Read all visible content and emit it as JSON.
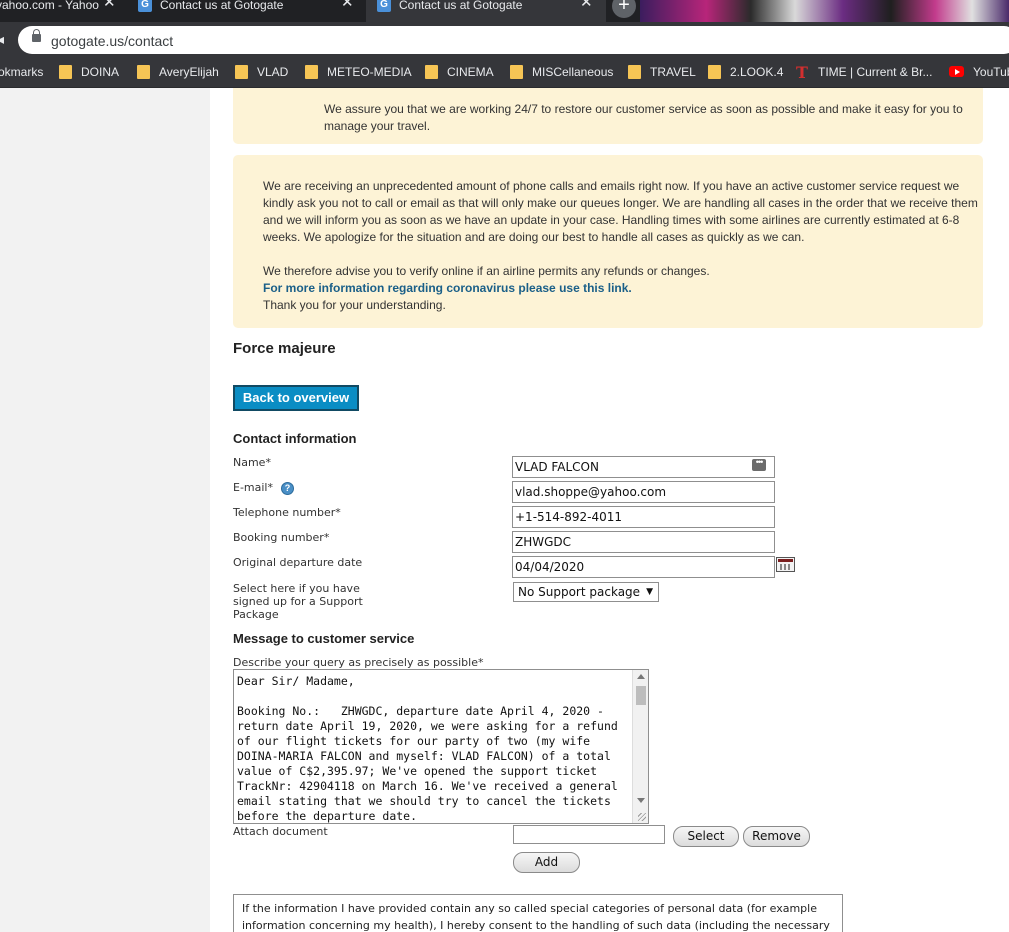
{
  "browser": {
    "tabs": [
      {
        "label": "yahoo.com - Yahoo"
      },
      {
        "label": "Contact us at Gotogate"
      },
      {
        "label": "Contact us at Gotogate"
      }
    ],
    "new_tab": "+",
    "url": "gotogate.us/contact",
    "bookmarks": [
      {
        "label": "okmarks"
      },
      {
        "label": "DOINA"
      },
      {
        "label": "AveryElijah"
      },
      {
        "label": "VLAD"
      },
      {
        "label": "METEO-MEDIA"
      },
      {
        "label": "CINEMA"
      },
      {
        "label": "MISCellaneous"
      },
      {
        "label": "TRAVEL"
      },
      {
        "label": "2.LOOK.4"
      },
      {
        "label": "TIME | Current & Br..."
      },
      {
        "label": "YouTub"
      }
    ]
  },
  "notice": {
    "first": "We assure you that we are working 24/7 to restore our customer service as soon as possible and make it easy for you to manage your travel.",
    "para1": "We are receiving an unprecedented amount of phone calls and emails right now. If you have an active customer service request we kindly ask you not to call or email as that will only make our queues longer. We are handling all cases in the order that we receive them and we will inform you as soon as we have an update in your case. Handling times with some airlines are currently estimated at 6-8 weeks. We apologize for the situation and are doing our best to handle all cases as quickly as we can.",
    "para2": "We therefore advise you to verify online if an airline permits any refunds or changes.",
    "link": "For more information regarding coronavirus please use this link.",
    "thanks": "Thank you for your understanding."
  },
  "headings": {
    "force": "Force majeure",
    "contact": "Contact information",
    "message": "Message to customer service"
  },
  "buttons": {
    "back": "Back to overview",
    "select": "Select",
    "remove": "Remove",
    "add": "Add"
  },
  "form": {
    "name_label": "Name*",
    "name_value": "VLAD FALCON",
    "email_label": "E-mail*",
    "email_value": "vlad.shoppe@yahoo.com",
    "phone_label": "Telephone number*",
    "phone_value": "+1-514-892-4011",
    "booking_label": "Booking number*",
    "booking_value": "ZHWGDC",
    "date_label": "Original departure date",
    "date_value": "04/04/2020",
    "package_label": "Select here if you have signed up for a Support Package",
    "package_value": "No Support package",
    "query_label": "Describe your query as precisely as possible*",
    "query_value": "Dear Sir/ Madame,\n\nBooking No.:   ZHWGDC, departure date April 4, 2020 - return date April 19, 2020, we were asking for a refund of our flight tickets for our party of two (my wife DOINA-MARIA FALCON and myself: VLAD FALCON) of a total value of C$2,395.97; We've opened the support ticket TrackNr: 42904118 on March 16. We've received a general email stating that we should try to cancel the tickets before the departure date.",
    "attach_label": "Attach document"
  },
  "consent": {
    "text": "If the information I have provided contain any so called special categories of personal data (for example information concerning my health), I hereby consent to the handling of such data (including the necessary"
  }
}
